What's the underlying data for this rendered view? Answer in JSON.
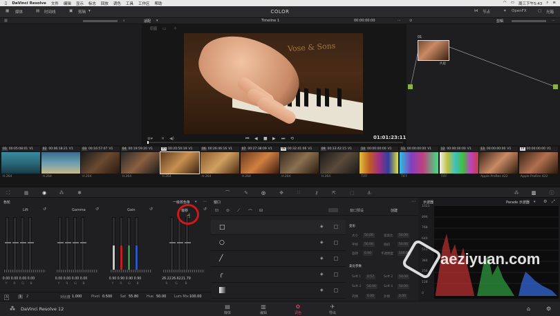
{
  "menubar": {
    "app": "DaVinci Resolve",
    "menus": [
      "文件",
      "编辑",
      "显示",
      "标志",
      "回放",
      "调色",
      "工具",
      "工作区",
      "帮助"
    ],
    "status": "周三下午5:43"
  },
  "toolbar": {
    "media": "媒体",
    "timeline": "时间线",
    "clip": "剪辑",
    "page_title": "COLOR",
    "node_label": "节点",
    "openfx_label": "OpenFX",
    "lightbox": "光箱"
  },
  "viewer": {
    "fit": "适配",
    "timeline_name": "Timeline 1",
    "tc_top": "00:00:00:00",
    "timecode": "01:01:23:11",
    "logo_text": "Vose & Sons"
  },
  "nodes": {
    "mode": "剪辑",
    "node_num": "01",
    "node_label": "片段"
  },
  "clips": [
    {
      "num": "01",
      "tc": "00:05:08:01",
      "track": "V1",
      "codec": "H.264"
    },
    {
      "num": "02",
      "tc": "00:06:18:21",
      "track": "V1",
      "codec": "H.264"
    },
    {
      "num": "03",
      "tc": "00:16:57:07",
      "track": "V1",
      "codec": "H.264"
    },
    {
      "num": "04",
      "tc": "00:19:59:20",
      "track": "V1",
      "codec": "H.264"
    },
    {
      "num": "05",
      "tc": "00:20:50:19",
      "track": "V1",
      "codec": "H.264"
    },
    {
      "num": "06",
      "tc": "00:26:46:16",
      "track": "V1",
      "codec": "H.264"
    },
    {
      "num": "07",
      "tc": "00:27:38:09",
      "track": "V1",
      "codec": "H.264"
    },
    {
      "num": "08",
      "tc": "00:32:41:06",
      "track": "V1",
      "codec": "H.264"
    },
    {
      "num": "09",
      "tc": "00:33:42:15",
      "track": "V1",
      "codec": "H.264"
    },
    {
      "num": "10",
      "tc": "00:00:00:00",
      "track": "V1",
      "codec": "TIFF"
    },
    {
      "num": "11",
      "tc": "00:00:00:00",
      "track": "V1",
      "codec": "TIFF"
    },
    {
      "num": "12",
      "tc": "00:00:00:00",
      "track": "V1",
      "codec": "TIFF"
    },
    {
      "num": "13",
      "tc": "00:00:00:00",
      "track": "V1",
      "codec": "Apple ProRes 422"
    },
    {
      "num": "14",
      "tc": "00:00:00:00",
      "track": "V1",
      "codec": "Apple ProRes 422"
    }
  ],
  "wheels": {
    "panel_title": "色轮",
    "mode": "一级校色条",
    "lift": {
      "label": "Lift",
      "values": [
        "0.00",
        "0.00",
        "0.00",
        "0.00"
      ]
    },
    "gamma": {
      "label": "Gamma",
      "values": [
        "0.00",
        "0.00",
        "0.00",
        "0.00"
      ]
    },
    "gain": {
      "label": "Gain",
      "values": [
        "0.90",
        "0.90",
        "0.90",
        "0.90"
      ]
    },
    "offset": {
      "label": "偏移",
      "values": [
        "26.22",
        "26.62",
        "21.79"
      ]
    },
    "channels4": [
      "Y",
      "R",
      "G",
      "B"
    ],
    "channels3": [
      "R",
      "G",
      "B"
    ],
    "footer": {
      "page_a": "A",
      "page_1": "1",
      "page_2": "2",
      "contrast_label": "对比度",
      "contrast": "1.000",
      "pivot_label": "Pivot",
      "pivot": "0.500",
      "sat_label": "Sat",
      "sat": "55.80",
      "hue_label": "Hue",
      "hue": "50.00",
      "lummix_label": "Lum Mix",
      "lummix": "100.00"
    }
  },
  "window": {
    "title": "窗口",
    "preset_label": "窗口预设",
    "create": "创建",
    "transform": "变形",
    "soft_params": "柔化参数",
    "fields": [
      "大小",
      "宽高比",
      "平移",
      "倾斜",
      "旋转",
      "不透明度"
    ],
    "field_values": [
      "50.00",
      "50.00",
      "50.00",
      "50.00",
      "0.00",
      "100.00"
    ],
    "soft_fields": [
      "Soft 1",
      "Soft 2",
      "Soft 3",
      "Soft 4",
      "内侧",
      "外侧"
    ],
    "soft_values": [
      "0.57",
      "50.00",
      "50.00",
      "50.00",
      "0.00",
      "0.00"
    ]
  },
  "scope": {
    "title": "示波器",
    "mode": "Parade 示波器",
    "ticks": [
      "1023",
      "896",
      "768",
      "640",
      "512",
      "384",
      "256",
      "128",
      "0"
    ]
  },
  "pagebar": {
    "app": "DaVinci Resolve 12",
    "pages": [
      "媒体",
      "编辑",
      "调色",
      "导出"
    ]
  },
  "watermark": "aeziyuan.com"
}
